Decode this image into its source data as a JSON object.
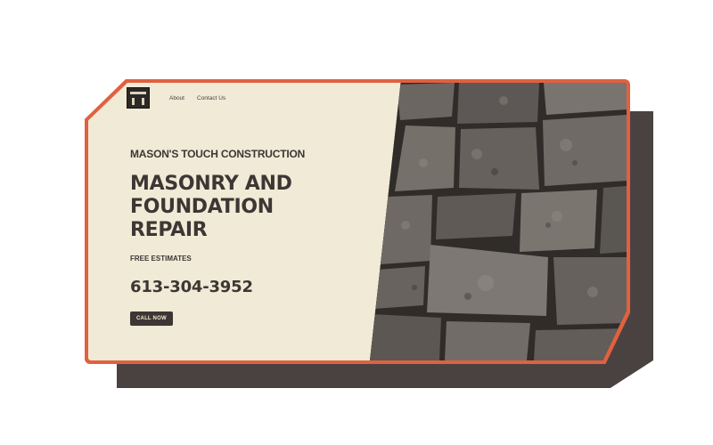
{
  "nav": {
    "logo_icon": "masons-touch-logo",
    "items": [
      {
        "label": "About"
      },
      {
        "label": "Contact Us"
      }
    ]
  },
  "hero": {
    "company_name": "MASON'S TOUCH CONSTRUCTION",
    "headline": "MASONRY AND FOUNDATION REPAIR",
    "subheading": "FREE ESTIMATES",
    "phone": "613-304-3952",
    "cta_label": "CALL NOW"
  },
  "colors": {
    "accent_border": "#e0613f",
    "background": "#f0ead6",
    "text_dark": "#3d3634",
    "shadow": "#4a4240"
  }
}
